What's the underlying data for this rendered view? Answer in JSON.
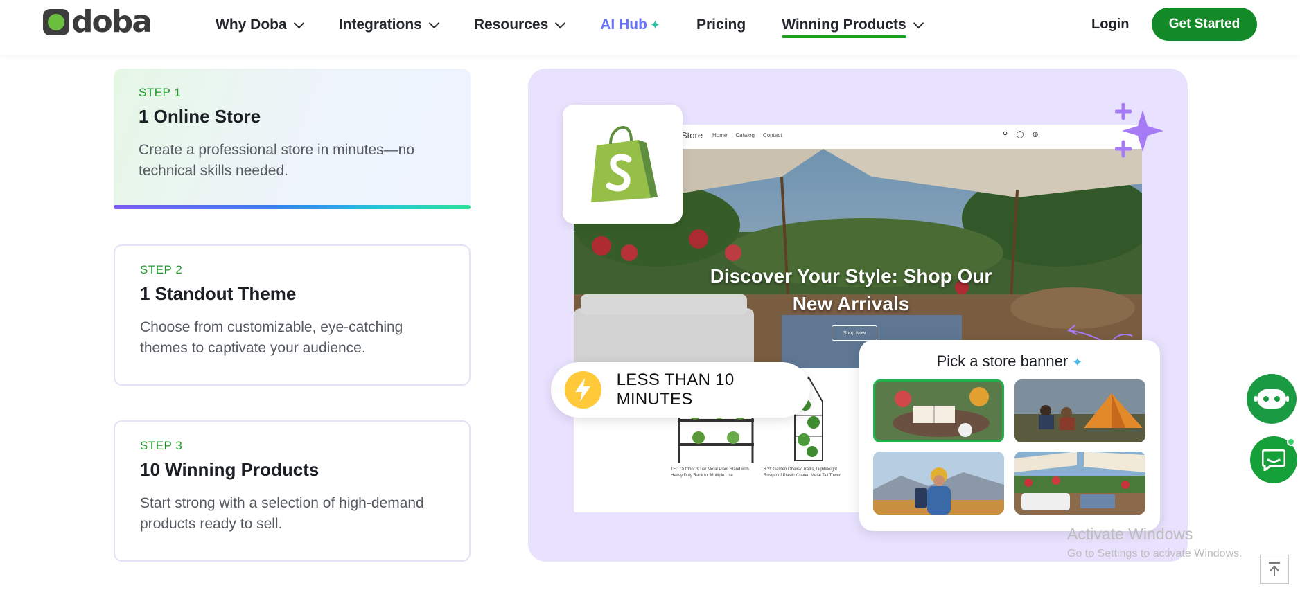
{
  "header": {
    "logo_text": "doba",
    "nav": {
      "why": "Why Doba",
      "integrations": "Integrations",
      "resources": "Resources",
      "ai_hub": "AI Hub",
      "pricing": "Pricing",
      "winning": "Winning Products"
    },
    "login": "Login",
    "get_started": "Get Started"
  },
  "steps": [
    {
      "label": "STEP 1",
      "title": "1 Online Store",
      "desc": "Create a professional store in minutes—no technical skills needed."
    },
    {
      "label": "STEP 2",
      "title": "1 Standout Theme",
      "desc": "Choose from customizable, eye-catching themes to captivate your audience."
    },
    {
      "label": "STEP 3",
      "title": "10 Winning Products",
      "desc": "Start strong with a selection of high-demand products ready to sell."
    }
  ],
  "showcase": {
    "store_name": "Store",
    "mock_nav": [
      "Home",
      "Catalog",
      "Contact"
    ],
    "hero_title": "Discover Your Style: Shop Our New Arrivals",
    "hero_button": "Shop Now",
    "products": [
      {
        "caption": "1FC Outdoor 3 Tier Metal Plant Stand with Heavy Duty Rack for Multiple Use"
      },
      {
        "caption": "6.2ft Garden Obelisk Trellis, Lightweight Rustproof Plastic Coated Metal Tall Tower"
      }
    ],
    "time_pill": "LESS THAN 10 MINUTES",
    "banner_title": "Pick a store banner",
    "banner_options": [
      "reading-garden-banner",
      "camping-banner",
      "hiker-banner",
      "patio-banner"
    ]
  },
  "watermark": {
    "line1": "Activate Windows",
    "line2": "Go to Settings to activate Windows."
  },
  "colors": {
    "brand_green": "#138a27",
    "step_label_green": "#1f9a28",
    "ai_blue": "#6573ff",
    "panel_lavender": "#e9e2ff"
  }
}
